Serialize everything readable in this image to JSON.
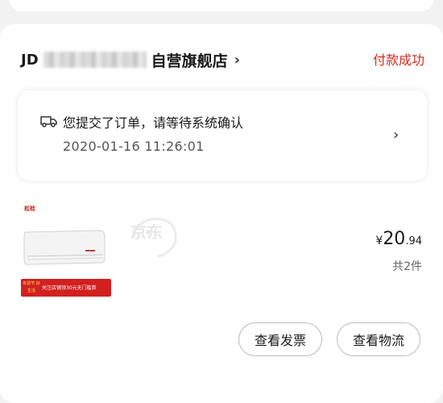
{
  "shop": {
    "prefix": "JD",
    "name": "自营旗舰店",
    "chevron": "›"
  },
  "order": {
    "status": "付款成功",
    "notice_title": "您提交了订单，请等待系统确认",
    "notice_time": "2020-01-16 11:26:01",
    "notice_chevron": "›",
    "notice_icon": "truck-icon"
  },
  "product": {
    "brand_mini": "松桂",
    "watermark": "京东",
    "promo_tag": "年货节 好生活",
    "promo_text": "关注店铺领30元无门槛券",
    "price_currency": "¥",
    "price_integer": "20",
    "price_decimal": ".94",
    "quantity": "共2件"
  },
  "actions": {
    "invoice": "查看发票",
    "logistics": "查看物流"
  },
  "colors": {
    "status_red": "#d9291c",
    "background": "#f2f2f2"
  }
}
